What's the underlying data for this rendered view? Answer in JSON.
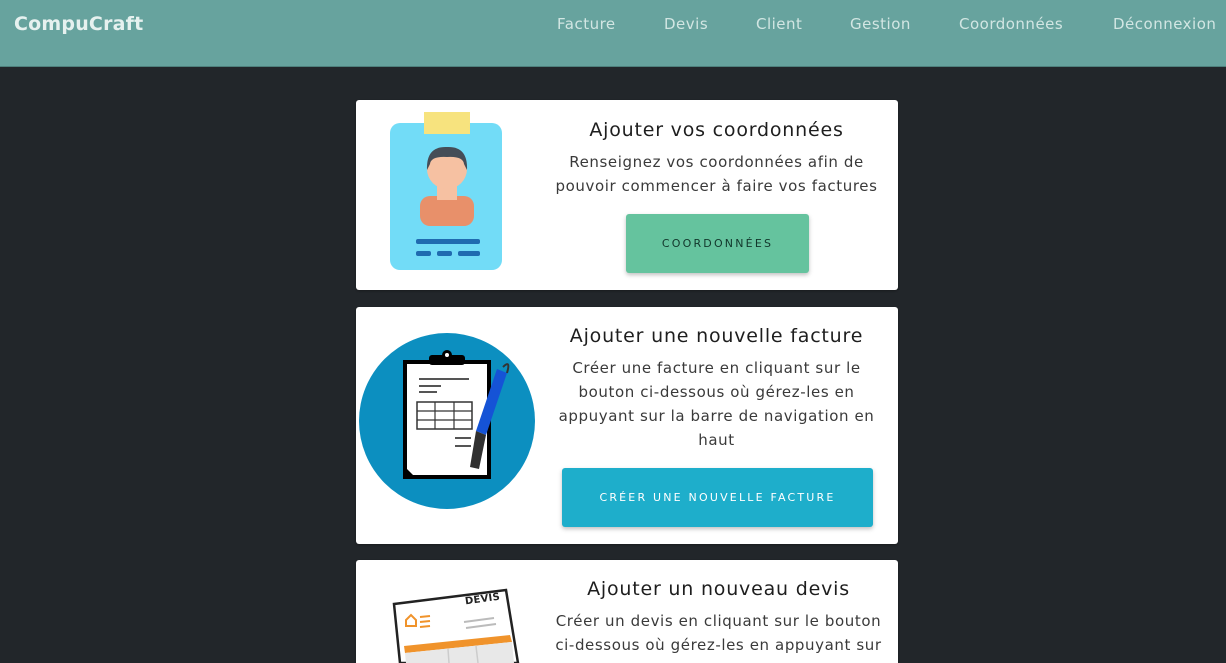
{
  "navbar": {
    "brand": "CompuCraft",
    "links": [
      "Facture",
      "Devis",
      "Client",
      "Gestion",
      "Coordonnées",
      "Déconnexion"
    ]
  },
  "cards": [
    {
      "title": "Ajouter vos coordonnées",
      "text": "Renseignez vos coordonnées afin de pouvoir commencer à faire vos factures",
      "button": "Coordonnées",
      "image_icon": "id-badge-icon"
    },
    {
      "title": "Ajouter une nouvelle facture",
      "text": "Créer une facture en cliquant sur le bouton ci-dessous où gérez-les en appuyant sur la barre de navigation en haut",
      "button": "Créer une nouvelle facture",
      "image_icon": "clipboard-pen-icon"
    },
    {
      "title": "Ajouter un nouveau devis",
      "text": "Créer un devis en cliquant sur le bouton ci-dessous où gérez-les en appuyant sur",
      "image_icon": "quote-document-icon",
      "image_label": "DEVIS"
    }
  ],
  "colors": {
    "navbar": "#67a39e",
    "background": "#22262a",
    "button_green": "#65c39e",
    "button_blue": "#1eaecb"
  }
}
